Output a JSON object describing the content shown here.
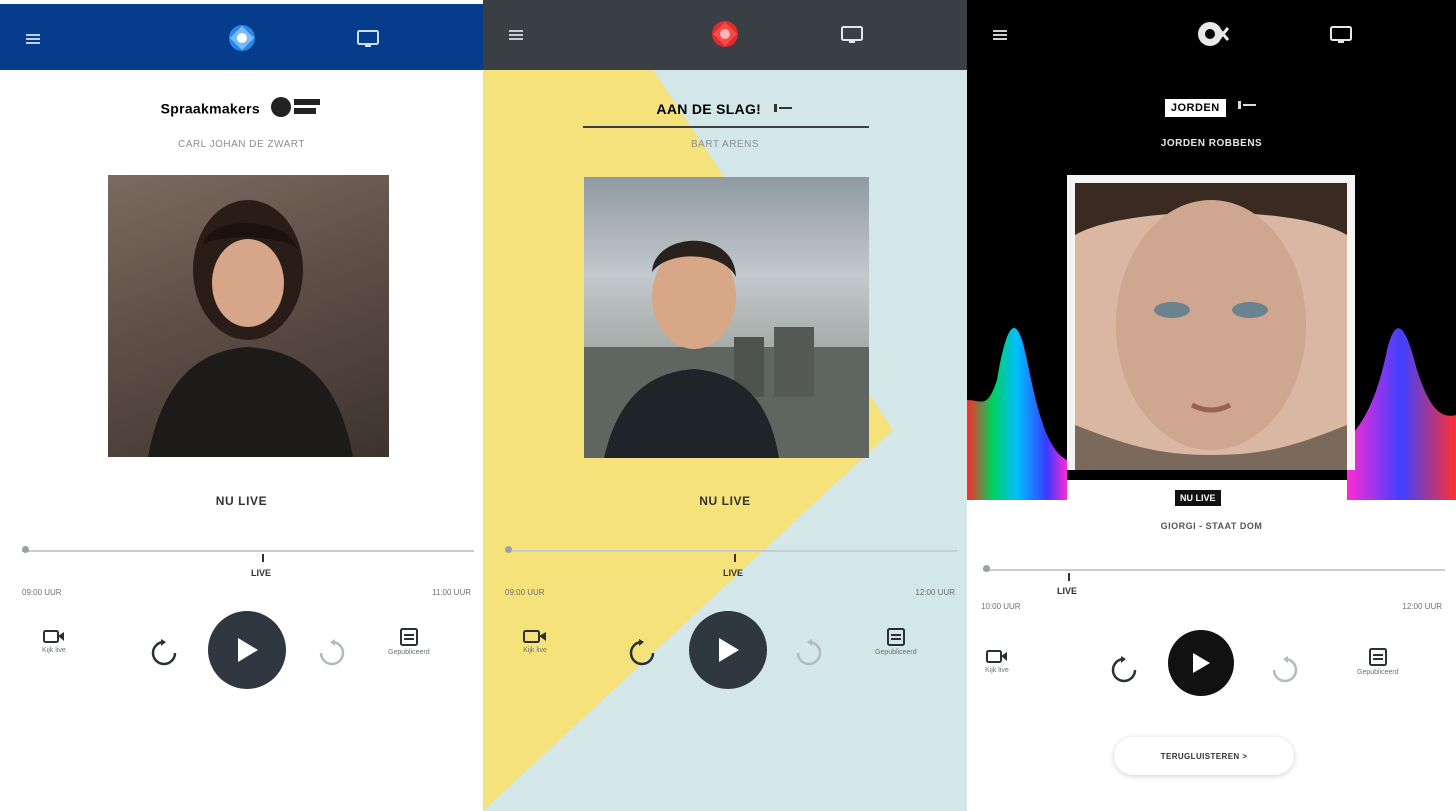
{
  "panels": [
    {
      "id": "nporadio1",
      "header_color": "#063c8c",
      "show_title": "Spraakmakers",
      "show_subtitle": "CARL JOHAN DE ZWART",
      "now_label": "NU LIVE",
      "live_label": "LIVE",
      "time_start": "09:00 UUR",
      "time_end": "11:00 UUR",
      "controls": {
        "left_label": "Kijk live",
        "right_label": "Gepubliceerd"
      }
    },
    {
      "id": "nporadio2",
      "header_color": "#3a3f45",
      "show_title": "AAN DE SLAG!",
      "show_subtitle": "BART ARENS",
      "now_label": "NU LIVE",
      "live_label": "LIVE",
      "time_start": "09:00 UUR",
      "time_end": "12:00 UUR",
      "controls": {
        "left_label": "Kijk live",
        "right_label": "Gepubliceerd"
      }
    },
    {
      "id": "npo3fm",
      "header_color": "#000000",
      "show_title": "JORDEN",
      "show_subtitle": "JORDEN ROBBENS",
      "now_label": "NU LIVE",
      "track_info": "GIORGI - STAAT DOM",
      "live_label": "LIVE",
      "time_start": "10:00 UUR",
      "time_end": "12:00 UUR",
      "controls": {
        "left_label": "Kijk live",
        "right_label": "Gepubliceerd"
      },
      "pill_label": "TERUGLUISTEREN >"
    }
  ],
  "colors": {
    "accent_yellow": "#f6e27a",
    "accent_teal": "#d3e6e8",
    "play_button": "#2f3740",
    "play_button_3fm": "#111111"
  }
}
